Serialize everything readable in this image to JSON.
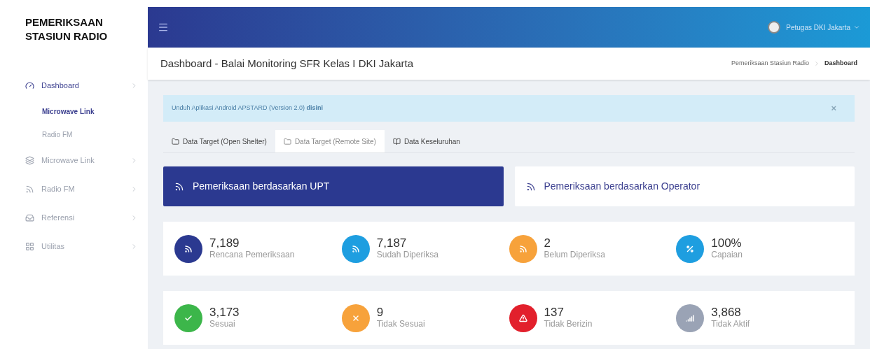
{
  "brand": "PEMERIKSAAN STASIUN RADIO",
  "sidebar": {
    "items": [
      {
        "label": "Dashboard",
        "kind": "gauge",
        "selected": true,
        "children": [
          {
            "label": "Microwave Link",
            "selected": true
          },
          {
            "label": "Radio FM",
            "selected": false
          }
        ]
      },
      {
        "label": "Microwave Link",
        "kind": "layers",
        "selected": false
      },
      {
        "label": "Radio FM",
        "kind": "rss",
        "selected": false
      },
      {
        "label": "Referensi",
        "kind": "inbox",
        "selected": false
      },
      {
        "label": "Utilitas",
        "kind": "grid",
        "selected": false
      }
    ]
  },
  "header": {
    "user": "Petugas DKI Jakarta"
  },
  "page_title": "Dashboard - Balai Monitoring SFR Kelas I DKI Jakarta",
  "breadcrumb": [
    {
      "label": "Pemeriksaan Stasiun Radio",
      "selected": false
    },
    {
      "label": "Dashboard",
      "selected": true
    }
  ],
  "alert": {
    "text": "Unduh Aplikasi Android APSTARD (Version 2.0) **disini**",
    "close": "×"
  },
  "tabs": [
    {
      "label": "Data Target (Open Shelter)",
      "kind": "folder",
      "selected": false
    },
    {
      "label": "Data Target (Remote Site)",
      "kind": "folder",
      "selected": true
    },
    {
      "label": "Data Keseluruhan",
      "kind": "book",
      "selected": false
    }
  ],
  "modes": [
    {
      "label": "Pemeriksaan berdasarkan UPT",
      "selected": true
    },
    {
      "label": "Pemeriksaan berdasarkan Operator",
      "selected": false
    }
  ],
  "stat_rows": [
    [
      {
        "value": "7,189",
        "label": "Rencana Pemeriksaan",
        "kind": "rss",
        "color": "#2b3990"
      },
      {
        "value": "7,187",
        "label": "Sudah Diperiksa",
        "kind": "rss",
        "color": "#1e9ee0"
      },
      {
        "value": "2",
        "label": "Belum Diperiksa",
        "kind": "rss",
        "color": "#f7a23b"
      },
      {
        "value": "100%",
        "label": "Capaian",
        "kind": "percent",
        "color": "#1e9ee0"
      }
    ],
    [
      {
        "value": "3,173",
        "label": "Sesuai",
        "kind": "check",
        "color": "#3cb64a"
      },
      {
        "value": "9",
        "label": "Tidak Sesuai",
        "kind": "cross",
        "color": "#f7a23b"
      },
      {
        "value": "137",
        "label": "Tidak Berizin",
        "kind": "warning",
        "color": "#e2202c"
      },
      {
        "value": "3,868",
        "label": "Tidak Aktif",
        "kind": "signal",
        "color": "#9aa3b5"
      }
    ]
  ]
}
